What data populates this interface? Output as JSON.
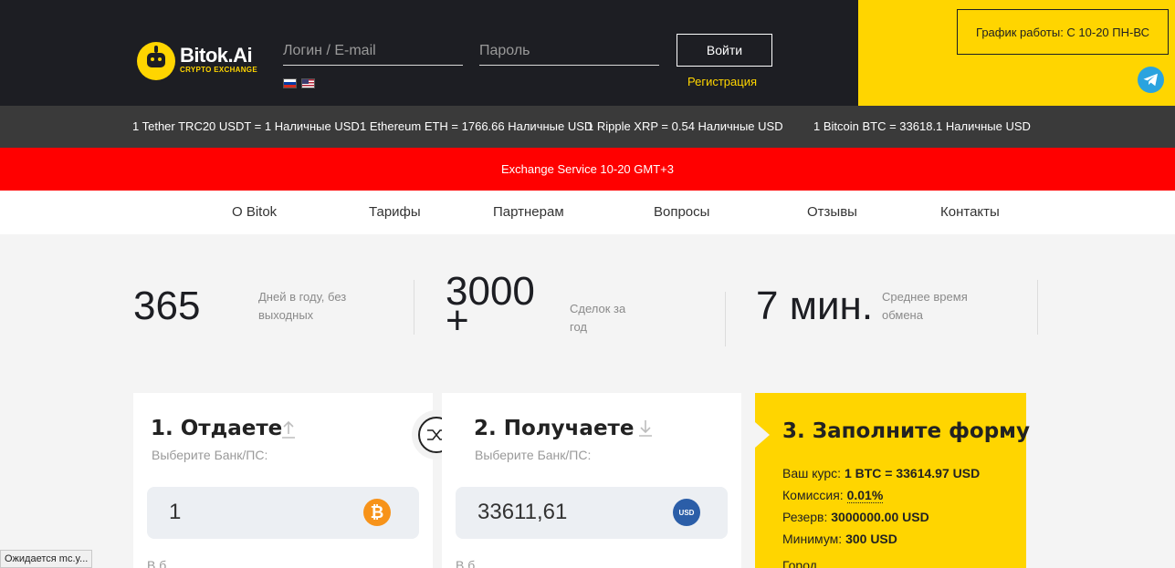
{
  "header": {
    "brand": "Bitok.Ai",
    "brand_sub": "CRYPTO EXCHANGE",
    "login_placeholder": "Логин / E-mail",
    "password_placeholder": "Пароль",
    "login_button": "Войти",
    "register_link": "Регистрация",
    "schedule": "График работы: С 10-20 ПН-ВС"
  },
  "ticker": [
    "1 Tether TRC20 USDT = 1 Наличные USD",
    "1 Ethereum ETH = 1766.66 Наличные USD",
    "1 Ripple XRP = 0.54 Наличные USD",
    "1 Bitcoin BTC = 33618.1 Наличные USD"
  ],
  "notice": "Exchange Service 10-20 GMT+3",
  "nav": [
    "О Bitok",
    "Тарифы",
    "Партнерам",
    "Вопросы",
    "Отзывы",
    "Контакты"
  ],
  "stats": [
    {
      "value": "365",
      "desc": "Дней в году, без выходных"
    },
    {
      "value": "3000",
      "suffix": "+",
      "desc": "Сделок за год"
    },
    {
      "value": "7 мин.",
      "desc": "Среднее время обмена"
    }
  ],
  "give": {
    "title": "1. Отдаете",
    "subtitle": "Выберите Банк/ПС:",
    "amount": "1",
    "coin": "BTC"
  },
  "receive": {
    "title": "2. Получаете",
    "subtitle": "Выберите Банк/ПС:",
    "amount": "33611,61",
    "coin": "USD"
  },
  "form": {
    "title": "3. Заполните форму",
    "rate_label": "Ваш курс:",
    "rate_value": "1 BTC = 33614.97 USD",
    "commission_label": "Комиссия:",
    "commission_value": "0.01%",
    "reserve_label": "Резерв:",
    "reserve_value": "3000000.00 USD",
    "minimum_label": "Минимум:",
    "minimum_value": "300 USD"
  },
  "status_bar": "Ожидается mc.y..."
}
